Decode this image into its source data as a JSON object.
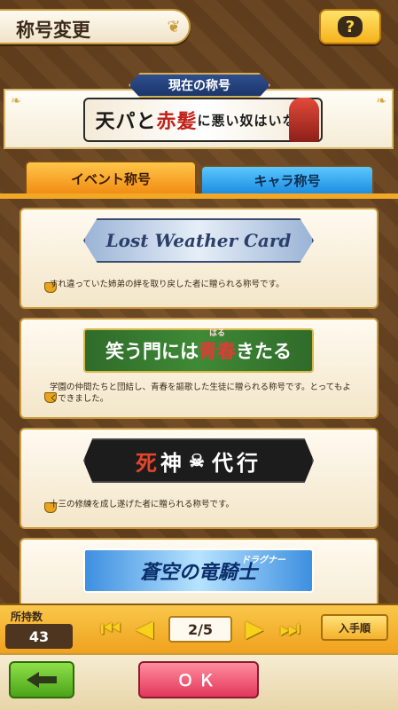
{
  "header": {
    "title": "称号変更",
    "help_label": "?"
  },
  "current": {
    "label": "現在の称号",
    "title_part1": "天パと",
    "title_red": "赤髪",
    "title_part2": "に悪い奴はいない"
  },
  "tabs": [
    {
      "label": "イベント称号",
      "active": true
    },
    {
      "label": "キャラ称号",
      "active": false
    }
  ],
  "titles": [
    {
      "banner": "Lost Weather Card",
      "description": "すれ違っていた姉弟の絆を取り戻した者に贈られる称号です。"
    },
    {
      "banner_part1": "笑う門には",
      "banner_red": "青春",
      "banner_part2": "きたる",
      "ruby": "はる",
      "description": "学園の仲間たちと団結し、青春を謳歌した生徒に贈られる称号です。とってもよくできました。"
    },
    {
      "banner_red": "死",
      "banner_part1": "神",
      "banner_part2": "代行",
      "description": "十三の修練を成し遂げた者に贈られる称号です。"
    },
    {
      "banner": "蒼空の竜騎士",
      "ruby": "ドラグナー",
      "description": ""
    }
  ],
  "footer_bar": {
    "own_label": "所持数",
    "own_count": "43",
    "page": "2/5",
    "sort_label": "入手順"
  },
  "actions": {
    "ok_label": "ＯＫ"
  },
  "colors": {
    "accent": "#f1a826",
    "ok": "#e2375a",
    "back": "#4aa418",
    "tab_chara": "#1a8be0"
  }
}
